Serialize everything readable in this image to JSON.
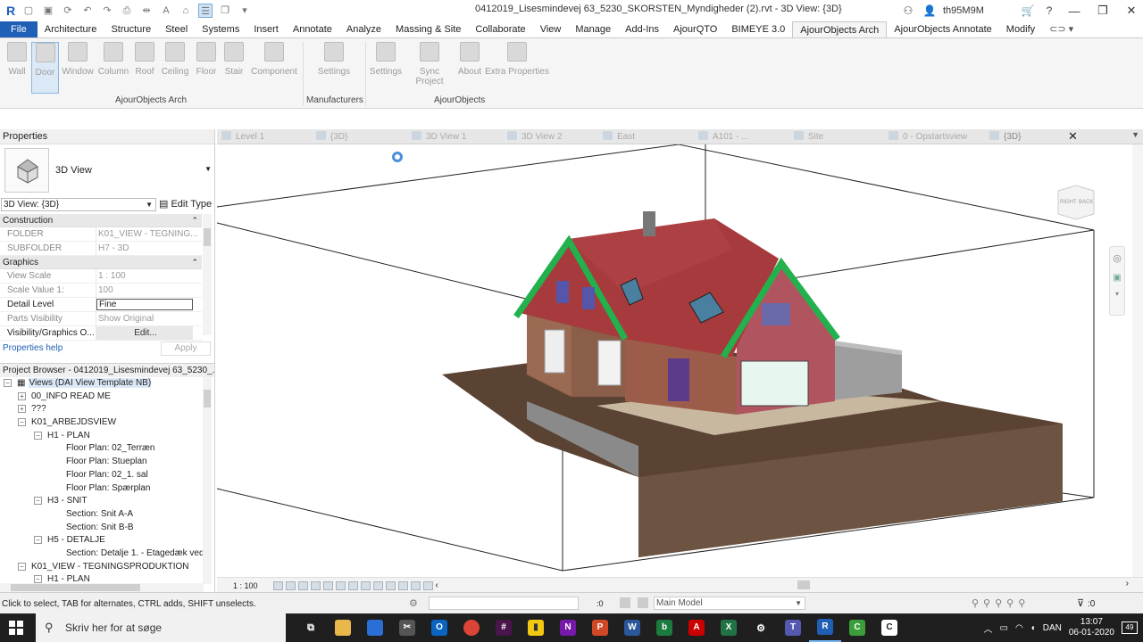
{
  "title": "0412019_Lisesmindevej 63_5230_SKORSTEN_Myndigheder (2).rvt - 3D View: {3D}",
  "user": "th95M9M",
  "ribbon_tabs": [
    "File",
    "Architecture",
    "Structure",
    "Steel",
    "Systems",
    "Insert",
    "Annotate",
    "Analyze",
    "Massing & Site",
    "Collaborate",
    "View",
    "Manage",
    "Add-Ins",
    "AjourQTO",
    "BIMEYE 3.0",
    "AjourObjects Arch",
    "AjourObjects Annotate",
    "Modify"
  ],
  "active_tab": "AjourObjects Arch",
  "ribbon_buttons": [
    "Wall",
    "Door",
    "Window",
    "Column",
    "Roof",
    "Ceiling",
    "Floor",
    "Stair",
    "Component",
    "Settings",
    "Settings",
    "Sync Project",
    "About",
    "Extra Properties"
  ],
  "ribbon_groups": [
    "AjourObjects Arch",
    "Manufacturers",
    "AjourObjects"
  ],
  "view_tabs": [
    "Level 1",
    "{3D}",
    "3D View 1",
    "3D View 2",
    "East",
    "A101 - ...",
    "Site",
    "0 - Opstartsview",
    "{3D}"
  ],
  "properties": {
    "header": "Properties",
    "type_name": "3D View",
    "selector": "3D View: {3D}",
    "edit_type": "Edit Type",
    "categories": [
      {
        "name": "Construction",
        "rows": [
          {
            "key": "FOLDER",
            "value": "K01_VIEW - TEGNING..."
          },
          {
            "key": "SUBFOLDER",
            "value": "H7 - 3D"
          }
        ]
      },
      {
        "name": "Graphics",
        "rows": [
          {
            "key": "View Scale",
            "value": "1 : 100"
          },
          {
            "key": "Scale Value    1:",
            "value": "100"
          },
          {
            "key": "Detail Level",
            "value": "Fine"
          },
          {
            "key": "Parts Visibility",
            "value": "Show Original"
          },
          {
            "key": "Visibility/Graphics O...",
            "value": "Edit..."
          }
        ]
      }
    ],
    "help": "Properties help",
    "apply": "Apply"
  },
  "browser": {
    "header": "Project Browser - 0412019_Lisesmindevej 63_5230_...",
    "nodes": [
      {
        "label": "Views (DAI View Template NB)",
        "toggle": "−"
      },
      {
        "label": "00_INFO READ ME",
        "toggle": "+"
      },
      {
        "label": "???",
        "toggle": "+"
      },
      {
        "label": "K01_ARBEJDSVIEW",
        "toggle": "−"
      },
      {
        "label": "H1 - PLAN",
        "toggle": "−"
      },
      {
        "label": "Floor Plan: 02_Terræn",
        "toggle": ""
      },
      {
        "label": "Floor Plan: Stueplan",
        "toggle": ""
      },
      {
        "label": "Floor Plan: 02_1. sal",
        "toggle": ""
      },
      {
        "label": "Floor Plan: Spærplan",
        "toggle": ""
      },
      {
        "label": "H3 - SNIT",
        "toggle": "−"
      },
      {
        "label": "Section: Snit A-A",
        "toggle": ""
      },
      {
        "label": "Section: Snit B-B",
        "toggle": ""
      },
      {
        "label": "H5 - DETALJE",
        "toggle": "−"
      },
      {
        "label": "Section: Detalje 1. - Etagedæk ved",
        "toggle": ""
      },
      {
        "label": "K01_VIEW - TEGNINGSPRODUKTION",
        "toggle": "−"
      },
      {
        "label": "H1 - PLAN",
        "toggle": "−"
      }
    ]
  },
  "viewcube": {
    "face_a": "RIGHT",
    "face_b": "BACK"
  },
  "view_scale": "1 : 100",
  "status": {
    "message": "Click to select, TAB for alternates, CTRL adds, SHIFT unselects.",
    "count": ":0",
    "model": "Main Model",
    "filter": ":0"
  },
  "taskbar": {
    "search": "Skriv her for at søge",
    "lang": "DAN",
    "time": "13:07",
    "date": "06-01-2020",
    "notifications": "49"
  },
  "colors": {
    "accent": "#1f5fb5",
    "roof": "#a63a3c",
    "trim": "#22b14c",
    "ground": "#5b4333"
  }
}
